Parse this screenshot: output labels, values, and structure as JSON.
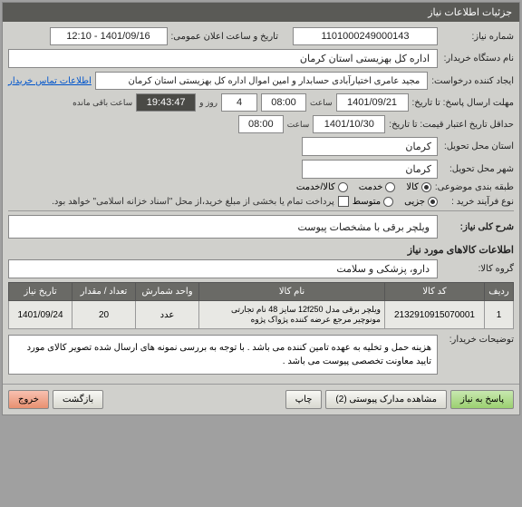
{
  "panel_title": "جزئیات اطلاعات نیاز",
  "fields": {
    "need_no_label": "شماره نیاز:",
    "need_no": "1101000249000143",
    "ann_dt_label": "تاریخ و ساعت اعلان عمومی:",
    "ann_dt": "1401/09/16 - 12:10",
    "buyer_label": "نام دستگاه خریدار:",
    "buyer": "اداره کل بهزیستی استان کرمان",
    "requester_label": "ایجاد کننده درخواست:",
    "requester": "مجید عامری اختیارآبادی حسابدار و امین اموال اداره کل بهزیستی استان کرمان",
    "contact_link": "اطلاعات تماس خریدار",
    "deadline_label": "مهلت ارسال پاسخ: تا تاریخ:",
    "deadline_date": "1401/09/21",
    "time_word": "ساعت",
    "deadline_time": "08:00",
    "days": "4",
    "day_and": "روز و",
    "countdown": "19:43:47",
    "remain": "ساعت باقی مانده",
    "valid_label": "حداقل تاریخ اعتبار قیمت: تا تاریخ:",
    "valid_date": "1401/10/30",
    "valid_time": "08:00",
    "loc_label": "استان محل تحویل:",
    "loc": "کرمان",
    "city_label": "شهر محل تحویل:",
    "city": "کرمان",
    "cat_label": "طبقه بندی موضوعی:",
    "cat_goods": "کالا",
    "cat_service": "خدمت",
    "cat_both": "کالا/خدمت",
    "buy_type_label": "نوع فرآیند خرید :",
    "buy_small": "جزیی",
    "buy_med": "متوسط",
    "pay_note": "پرداخت تمام یا بخشی از مبلغ خرید،از محل \"اسناد خزانه اسلامی\" خواهد بود."
  },
  "need_title_label": "شرح کلی نیاز:",
  "need_title": "ویلچر برقی با مشخصات پیوست",
  "items_section": "اطلاعات کالاهای مورد نیاز",
  "group_label": "گروه کالا:",
  "group": "دارو، پزشکی و سلامت",
  "table": {
    "headers": {
      "row": "ردیف",
      "code": "کد کالا",
      "name": "نام کالا",
      "unit": "واحد شمارش",
      "qty": "تعداد / مقدار",
      "date": "تاریخ نیاز"
    },
    "rows": [
      {
        "row": "1",
        "code": "2132910915070001",
        "name": "ویلچر برقی مدل 12f250 سایز 48 نام تجارتی مونوچیر مرجع عرضه کننده پژواک پژوه",
        "unit": "عدد",
        "qty": "20",
        "date": "1401/09/24"
      }
    ]
  },
  "buyer_note_label": "توضیحات خریدار:",
  "buyer_note": "هزینه حمل و تخلیه به عهده تامین کننده می باشد . با توجه به بررسی نمونه های ارسال شده تصویر کالای مورد تایید معاونت تخصصی پیوست می باشد .",
  "buttons": {
    "reply": "پاسخ به نیاز",
    "attach": "مشاهده مدارک پیوستی (2)",
    "print": "چاپ",
    "back": "بازگشت",
    "exit": "خروج"
  }
}
